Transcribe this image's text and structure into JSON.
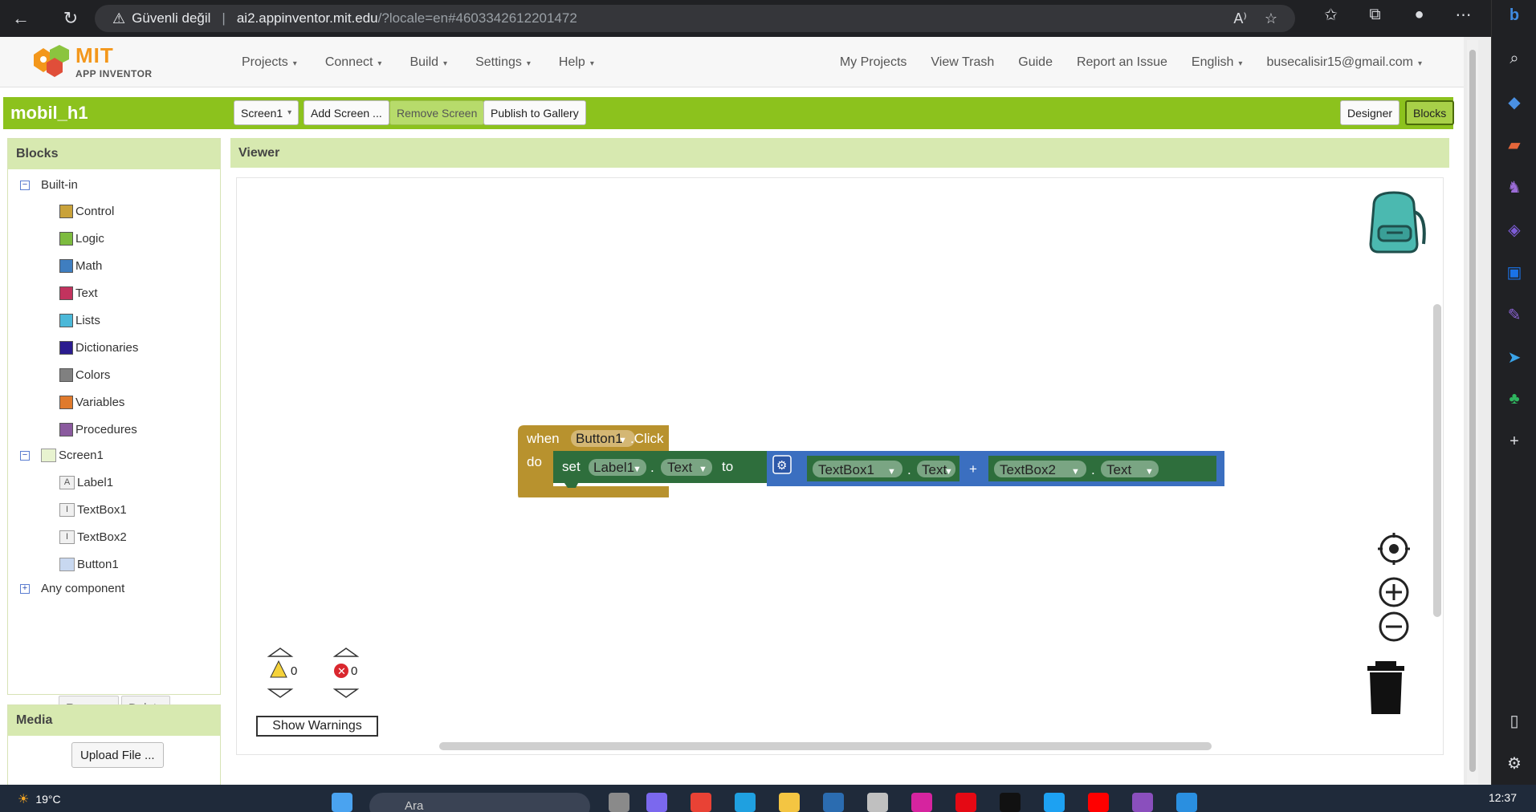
{
  "browser": {
    "security_label": "Güvenli değil",
    "url_host": "ai2.appinventor.mit.edu",
    "url_path": "/?locale=en#4603342612201472"
  },
  "logo": {
    "line1": "MIT",
    "line2": "APP INVENTOR"
  },
  "nav": {
    "left": [
      "Projects",
      "Connect",
      "Build",
      "Settings",
      "Help"
    ],
    "my_projects": "My Projects",
    "view_trash": "View Trash",
    "guide": "Guide",
    "report": "Report an Issue",
    "language": "English",
    "account": "busecalisir15@gmail.com"
  },
  "project": {
    "name": "mobil_h1",
    "screen_select": "Screen1",
    "add_screen": "Add Screen ...",
    "remove_screen": "Remove Screen",
    "publish": "Publish to Gallery",
    "designer": "Designer",
    "blocks": "Blocks"
  },
  "blocks_panel": {
    "title": "Blocks",
    "builtin": "Built-in",
    "categories": [
      {
        "label": "Control",
        "color": "#c9a23a"
      },
      {
        "label": "Logic",
        "color": "#7dbb3f"
      },
      {
        "label": "Math",
        "color": "#3f7ec0"
      },
      {
        "label": "Text",
        "color": "#c2335e"
      },
      {
        "label": "Lists",
        "color": "#4bb8d8"
      },
      {
        "label": "Dictionaries",
        "color": "#2b1c8f"
      },
      {
        "label": "Colors",
        "color": "#808080"
      },
      {
        "label": "Variables",
        "color": "#e07a2c"
      },
      {
        "label": "Procedures",
        "color": "#8a5a9e"
      }
    ],
    "screen": "Screen1",
    "components": [
      "Label1",
      "TextBox1",
      "TextBox2",
      "Button1"
    ],
    "any_component": "Any component",
    "rename": "Rename",
    "delete": "Delete"
  },
  "media_panel": {
    "title": "Media",
    "upload": "Upload File ..."
  },
  "viewer": {
    "title": "Viewer",
    "event": {
      "when": "when",
      "component": "Button1",
      "event": ".Click",
      "do": "do"
    },
    "setter": {
      "set": "set",
      "component": "Label1",
      "dot": ".",
      "property": "Text",
      "to": "to"
    },
    "join": {
      "left_component": "TextBox1",
      "left_property": "Text",
      "operator": "+",
      "right_component": "TextBox2",
      "right_property": "Text"
    },
    "warnings_count": "0",
    "errors_count": "0",
    "show_warnings": "Show Warnings"
  },
  "taskbar": {
    "temperature": "19°C",
    "search_placeholder": "Ara",
    "time": "12:37"
  }
}
